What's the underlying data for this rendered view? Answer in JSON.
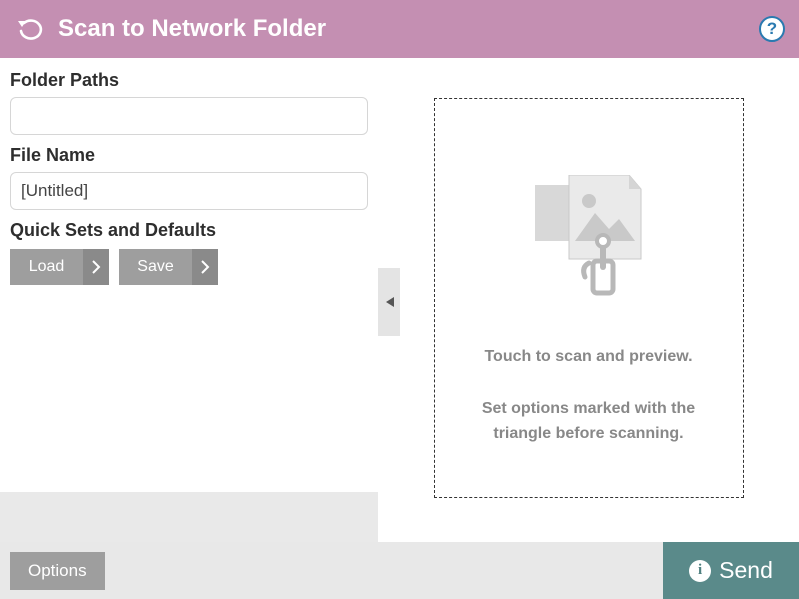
{
  "header": {
    "title": "Scan to Network Folder"
  },
  "form": {
    "folder_paths_label": "Folder Paths",
    "folder_paths_value": "",
    "file_name_label": "File Name",
    "file_name_value": "[Untitled]",
    "quick_sets_label": "Quick Sets and Defaults",
    "load_label": "Load",
    "save_label": "Save"
  },
  "preview": {
    "line1": "Touch to scan and preview.",
    "line2": "Set options marked with the",
    "line3": "triangle before scanning."
  },
  "footer": {
    "options_label": "Options",
    "send_label": "Send"
  }
}
